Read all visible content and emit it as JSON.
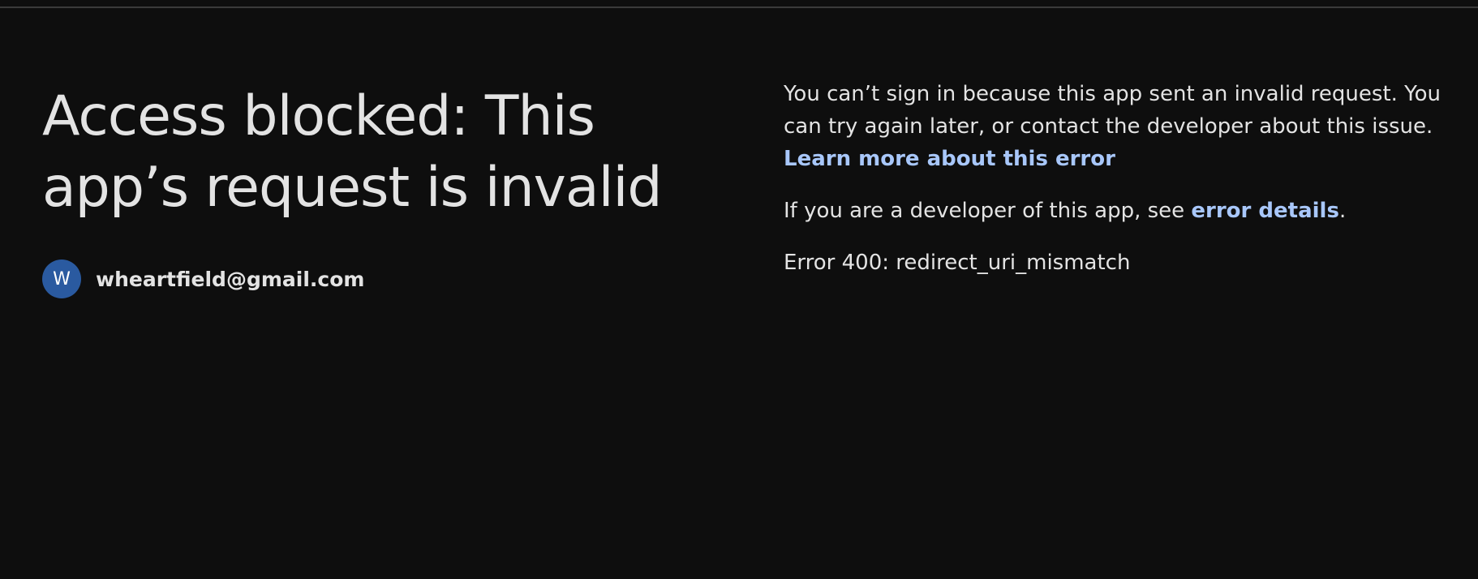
{
  "page": {
    "headline": "Access blocked: This app’s request is invalid"
  },
  "account": {
    "avatar_letter": "W",
    "email": "wheartfield@gmail.com"
  },
  "message": {
    "body": "You can’t sign in because this app sent an invalid request. You can try again later, or contact the developer about this issue.",
    "learn_more_link": "Learn more about this error",
    "developer_prefix": "If you are a developer of this app, see ",
    "error_details_link": "error details",
    "developer_suffix": ".",
    "error_code": "Error 400: redirect_uri_mismatch"
  },
  "colors": {
    "background": "#0e0e0e",
    "text": "#e3e3e3",
    "link": "#a8c7fa",
    "avatar": "#2a5aa0"
  },
  "icons": {
    "avatar": "letter-avatar"
  }
}
